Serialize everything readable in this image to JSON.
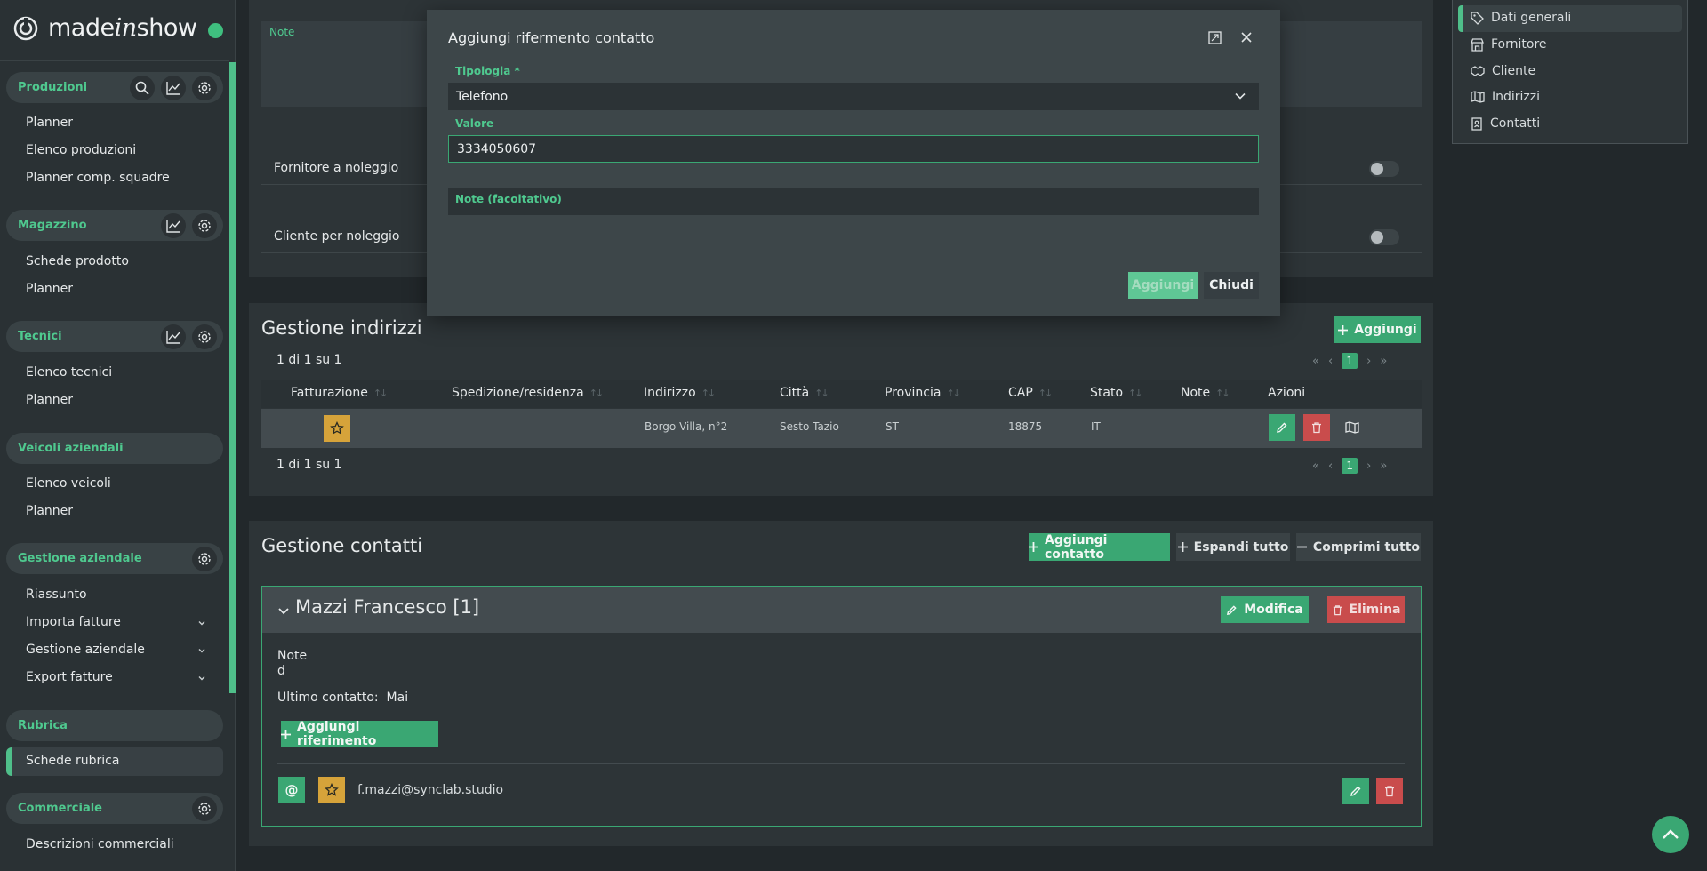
{
  "app": {
    "logo_pre": "made",
    "logo_mid": "in",
    "logo_post": "show"
  },
  "sidebar": {
    "sections": [
      {
        "label": "Produzioni",
        "items": [
          "Planner",
          "Elenco produzioni",
          "Planner comp. squadre"
        ]
      },
      {
        "label": "Magazzino",
        "items": [
          "Schede prodotto",
          "Planner"
        ]
      },
      {
        "label": "Tecnici",
        "items": [
          "Elenco tecnici",
          "Planner"
        ]
      },
      {
        "label": "Veicoli aziendali",
        "items": [
          "Elenco veicoli",
          "Planner"
        ]
      },
      {
        "label": "Gestione aziendale",
        "items": [
          "Riassunto",
          "Importa fatture",
          "Gestione aziendale",
          "Export fatture"
        ]
      },
      {
        "label": "Rubrica",
        "items": [
          "Schede rubrica"
        ]
      },
      {
        "label": "Commerciale",
        "items": [
          "Descrizioni commerciali"
        ]
      }
    ]
  },
  "general": {
    "note_label": "Note",
    "fornitore_noleggio": "Fornitore a noleggio",
    "cliente_noleggio": "Cliente per noleggio"
  },
  "addresses": {
    "title": "Gestione indirizzi",
    "add_label": "Aggiungi",
    "count_top": "1 di 1 su 1",
    "count_bottom": "1 di 1 su 1",
    "page": "1",
    "columns": [
      "Fatturazione",
      "Spedizione/residenza",
      "Indirizzo",
      "Città",
      "Provincia",
      "CAP",
      "Stato",
      "Note",
      "Azioni"
    ],
    "rows": [
      {
        "indirizzo": "Borgo Villa, n°2",
        "citta": "Sesto Tazio",
        "provincia": "ST",
        "cap": "18875",
        "stato": "IT",
        "note": ""
      }
    ]
  },
  "contacts": {
    "title": "Gestione contatti",
    "add_contact": "Aggiungi contatto",
    "expand_all": "Espandi tutto",
    "collapse_all": "Comprimi tutto",
    "card": {
      "name": "Mazzi Francesco [1]",
      "edit": "Modifica",
      "delete": "Elimina",
      "note_label": "Note",
      "note_value": "d",
      "last_contact_label": "Ultimo contatto:",
      "last_contact_value": "Mai",
      "add_reference": "Aggiungi riferimento",
      "reference": {
        "type_symbol": "@",
        "value": "f.mazzi@synclab.studio"
      }
    }
  },
  "right_nav": {
    "items": [
      "Dati generali",
      "Fornitore",
      "Cliente",
      "Indirizzi",
      "Contatti"
    ]
  },
  "modal": {
    "title": "Aggiungi rifermento contatto",
    "tipologia_label": "Tipologia *",
    "tipologia_value": "Telefono",
    "valore_label": "Valore",
    "valore_value": "3334050607",
    "note_label": "Note (facoltativo)",
    "add_button": "Aggiungi",
    "close_button": "Chiudi"
  },
  "colors": {
    "accent": "#3aa773",
    "danger": "#c94c4c",
    "warning": "#d6a33a",
    "background": "#22282b"
  }
}
